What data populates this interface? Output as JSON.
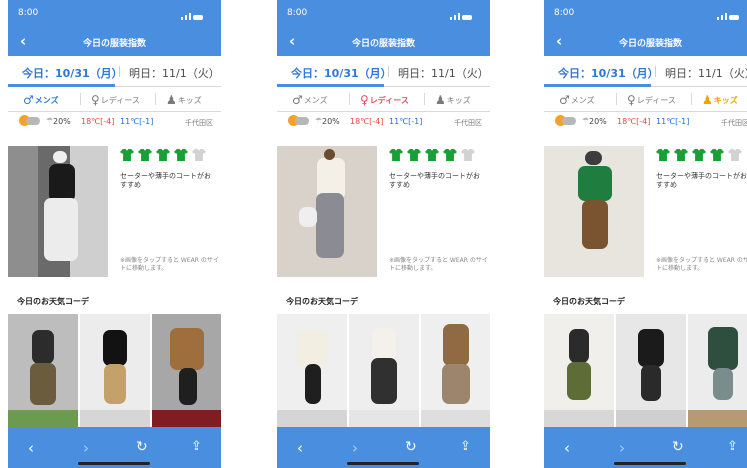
{
  "phones": [
    {
      "status_time": "8:00",
      "nav_title": "今日の服装指数",
      "tabs": {
        "today": "今日：10/31（月）",
        "tomorrow": "明日：11/1（火）"
      },
      "genders": {
        "mens": "メンズ",
        "ladies": "レディース",
        "kids": "キッズ",
        "active": "mens",
        "active_color": "#2f78d6"
      },
      "weather": {
        "precipitation": "20%",
        "high": "18℃[-4]",
        "low": "11℃[-1]",
        "location": "千代田区"
      },
      "recommendation": {
        "text": "セーターや薄手のコートがおすすめ",
        "note": "※画像をタップすると WEAR のサイトに移動します。"
      },
      "section_title": "今日のお天気コーデ"
    },
    {
      "status_time": "8:00",
      "nav_title": "今日の服装指数",
      "tabs": {
        "today": "今日：10/31（月）",
        "tomorrow": "明日：11/1（火）"
      },
      "genders": {
        "mens": "メンズ",
        "ladies": "レディース",
        "kids": "キッズ",
        "active": "ladies",
        "active_color": "#e04f5f"
      },
      "weather": {
        "precipitation": "20%",
        "high": "18℃[-4]",
        "low": "11℃[-1]",
        "location": "千代田区"
      },
      "recommendation": {
        "text": "セーターや薄手のコートがおすすめ",
        "note": "※画像をタップすると WEAR のサイトに移動します。"
      },
      "section_title": "今日のお天気コーデ"
    },
    {
      "status_time": "8:00",
      "nav_title": "今日の服装指数",
      "tabs": {
        "today": "今日：10/31（月）",
        "tomorrow": "明日：11/1（火）"
      },
      "genders": {
        "mens": "メンズ",
        "ladies": "レディース",
        "kids": "キッズ",
        "active": "kids",
        "active_color": "#f0a000"
      },
      "weather": {
        "precipitation": "20%",
        "high": "18℃[-4]",
        "low": "11℃[-1]",
        "location": "千代田区"
      },
      "recommendation": {
        "text": "セーターや薄手のコートがおすすめ",
        "note": "※画像をタップすると WEAR のサイトに移動します。"
      },
      "section_title": "今日のお天気コーデ"
    }
  ],
  "colors": {
    "header": "#4a8ee0",
    "shirt_green": "#18a037",
    "shirt_grey": "#d2d2d2"
  },
  "icons": {
    "back": "chevron-left-icon",
    "forward": "chevron-right-icon",
    "reload": "reload-icon",
    "share": "share-icon",
    "male": "male-person-icon",
    "female": "female-person-icon",
    "kids": "kids-icon",
    "sun_cloud": "sun-cloud-icon",
    "umbrella": "umbrella-icon",
    "shirt": "shirt-icon"
  }
}
